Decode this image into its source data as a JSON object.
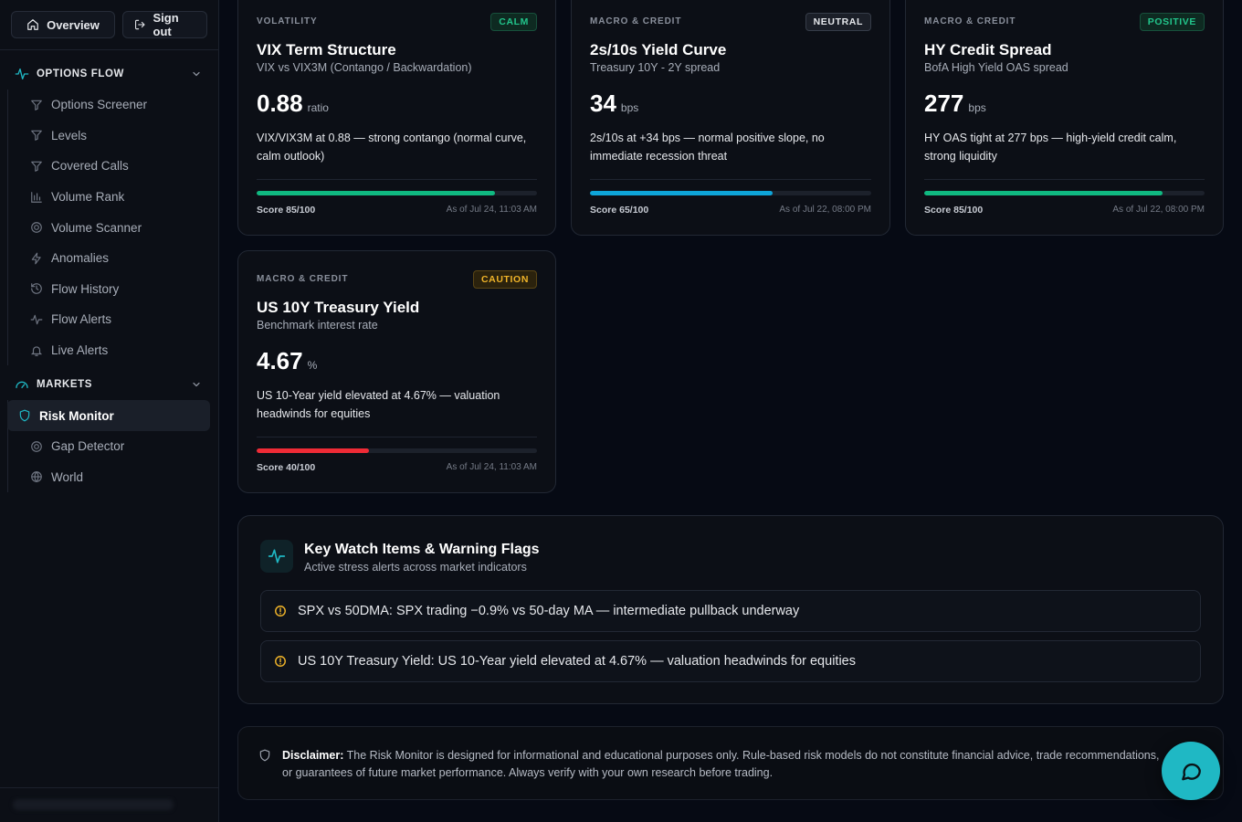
{
  "sidebar": {
    "overview_label": "Overview",
    "signout_label": "Sign out",
    "options_flow": {
      "title": "OPTIONS FLOW",
      "items": [
        {
          "label": "Options Screener",
          "icon": "filter-icon"
        },
        {
          "label": "Levels",
          "icon": "filter-icon"
        },
        {
          "label": "Covered Calls",
          "icon": "filter-icon"
        },
        {
          "label": "Volume Rank",
          "icon": "bar-chart-icon"
        },
        {
          "label": "Volume Scanner",
          "icon": "radar-icon"
        },
        {
          "label": "Anomalies",
          "icon": "zap-icon"
        },
        {
          "label": "Flow History",
          "icon": "history-icon"
        },
        {
          "label": "Flow Alerts",
          "icon": "pulse-icon"
        },
        {
          "label": "Live Alerts",
          "icon": "bell-icon"
        }
      ]
    },
    "markets": {
      "title": "MARKETS",
      "items": [
        {
          "label": "Risk Monitor",
          "icon": "shield-icon",
          "active": true
        },
        {
          "label": "Gap Detector",
          "icon": "radar-icon"
        },
        {
          "label": "World",
          "icon": "globe-icon"
        }
      ]
    }
  },
  "cards": [
    {
      "category": "VOLATILITY",
      "badge": "CALM",
      "title": "VIX Term Structure",
      "subtitle": "VIX vs VIX3M (Contango / Backwardation)",
      "value": "0.88",
      "unit": "ratio",
      "description": "VIX/VIX3M at 0.88 — strong contango (normal curve, calm outlook)",
      "score_label": "Score 85/100",
      "score": 85,
      "bar_color": "#10b981",
      "as_of": "As of Jul 24, 11:03 AM"
    },
    {
      "category": "MACRO & CREDIT",
      "badge": "NEUTRAL",
      "title": "2s/10s Yield Curve",
      "subtitle": "Treasury 10Y - 2Y spread",
      "value": "34",
      "unit": "bps",
      "description": "2s/10s at +34 bps — normal positive slope, no immediate recession threat",
      "score_label": "Score 65/100",
      "score": 65,
      "bar_color": "#0ea5d9",
      "as_of": "As of Jul 22, 08:00 PM"
    },
    {
      "category": "MACRO & CREDIT",
      "badge": "POSITIVE",
      "title": "HY Credit Spread",
      "subtitle": "BofA High Yield OAS spread",
      "value": "277",
      "unit": "bps",
      "description": "HY OAS tight at 277 bps — high-yield credit calm, strong liquidity",
      "score_label": "Score 85/100",
      "score": 85,
      "bar_color": "#10b981",
      "as_of": "As of Jul 22, 08:00 PM"
    },
    {
      "category": "MACRO & CREDIT",
      "badge": "CAUTION",
      "title": "US 10Y Treasury Yield",
      "subtitle": "Benchmark interest rate",
      "value": "4.67",
      "unit": "%",
      "description": "US 10-Year yield elevated at 4.67% — valuation headwinds for equities",
      "score_label": "Score 40/100",
      "score": 40,
      "bar_color": "#ef2b36",
      "as_of": "As of Jul 24, 11:03 AM"
    }
  ],
  "watch": {
    "title": "Key Watch Items & Warning Flags",
    "subtitle": "Active stress alerts across market indicators",
    "alerts": [
      "SPX vs 50DMA: SPX trading −0.9% vs 50-day MA — intermediate pullback underway",
      "US 10Y Treasury Yield: US 10-Year yield elevated at 4.67% — valuation headwinds for equities"
    ]
  },
  "disclaimer": {
    "label": "Disclaimer:",
    "text": "The Risk Monitor is designed for informational and educational purposes only. Rule-based risk models do not constitute financial advice, trade recommendations, or guarantees of future market performance. Always verify with your own research before trading."
  },
  "colors": {
    "accent": "#1fb8c4",
    "positive": "#22c58b",
    "caution": "#f0b429",
    "danger": "#ef2b36"
  }
}
